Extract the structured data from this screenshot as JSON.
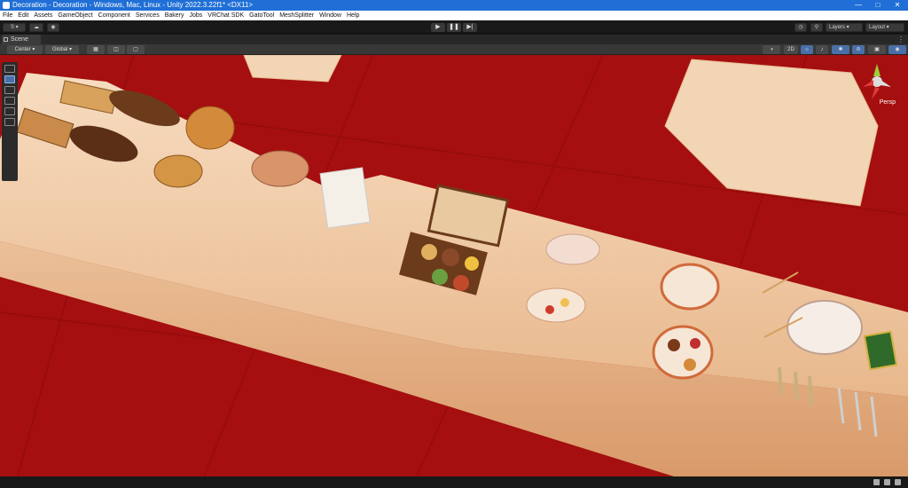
{
  "window": {
    "title": "Decoration - Decoration - Windows, Mac, Linux - Unity 2022.3.22f1* <DX11>"
  },
  "menu": [
    "File",
    "Edit",
    "Assets",
    "GameObject",
    "Component",
    "Services",
    "Bakery",
    "Jobs",
    "VRChat SDK",
    "GatoTool",
    "MeshSplitter",
    "Window",
    "Help"
  ],
  "toolbar": {
    "account": "S",
    "layers": "Layers",
    "layout": "Layout"
  },
  "scene_tab": {
    "label": "Scene"
  },
  "scene_toolbar": {
    "pivot": "Center",
    "space": "Global",
    "mode_2d": "2D"
  },
  "gizmo": {
    "label": "Persp"
  }
}
